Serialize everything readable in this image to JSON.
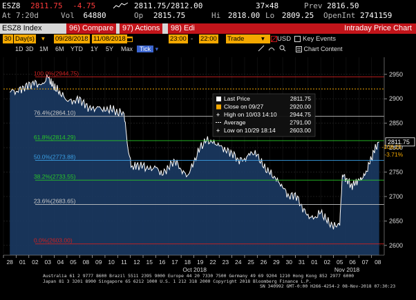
{
  "quote": {
    "ticker": "ESZ8",
    "last": "2811.75",
    "change": "-4.75",
    "bid_ask": "2811.75/2812.00",
    "size": "37×48",
    "prev_label": "Prev",
    "prev": "2816.50",
    "at_label": "At",
    "time": "7:20d",
    "vol_label": "Vol",
    "vol": "64880",
    "op_label": "Op",
    "open": "2815.75",
    "hi_label": "Hi",
    "high": "2818.00",
    "lo_label": "Lo",
    "low": "2809.25",
    "oi_label": "OpenInt",
    "open_int": "2741159"
  },
  "toolbar": {
    "security": "ESZ8 Index",
    "compare": "96) Compare",
    "actions": "97) Actions",
    "edit": "98) Edit",
    "title": "Intraday Price Chart"
  },
  "options": {
    "period_count": "30",
    "period_unit": "Day(s)",
    "start_date": "09/28/2018",
    "end_date": "11/08/2018",
    "start_time": "23:00",
    "end_time": "22:00",
    "field": "Trade",
    "currency": "USD",
    "key_events": "Key Events"
  },
  "ranges": {
    "items": [
      "1D",
      "3D",
      "1M",
      "6M",
      "YTD",
      "1Y",
      "5Y",
      "Max"
    ],
    "selected": "Tick",
    "chart_content": "Chart Content"
  },
  "legend": {
    "last_price_label": "Last Price",
    "last_price_value": "2811.75",
    "close_label": "Close on 09/27",
    "close_value": "2920.00",
    "high_label": "High on 10/03 14:10",
    "high_value": "2944.75",
    "avg_label": "Average",
    "avg_value": "2791.00",
    "low_label": "Low on 10/29 18:14",
    "low_value": "2603.00"
  },
  "annotations": {
    "last_tag": "2811.75",
    "change_pts": "-108.25",
    "change_pct": "-3.71%"
  },
  "fib_levels": [
    {
      "label": "100.0%(2944.75)",
      "value": 2944.75,
      "color": "#d02020"
    },
    {
      "label": "76.4%(2864.10)",
      "value": 2864.1,
      "color": "#c8c8c8"
    },
    {
      "label": "61.8%(2814.29)",
      "value": 2814.29,
      "color": "#28c828"
    },
    {
      "label": "50.0%(2773.88)",
      "value": 2773.88,
      "color": "#3aa0e6"
    },
    {
      "label": "38.2%(2733.55)",
      "value": 2733.55,
      "color": "#28c828"
    },
    {
      "label": "23.6%(2683.65)",
      "value": 2683.65,
      "color": "#c8c8c8"
    },
    {
      "label": "0.0%(2603.00)",
      "value": 2603.0,
      "color": "#d02020"
    }
  ],
  "footer": {
    "line1": "Australia 61 2 9777 8600 Brazil 5511 2395 9000 Europe 44 20 7330 7500 Germany 49 69 9204 1210 Hong Kong 852 2977 6000",
    "line2": "Japan 81 3 3201 8900         Singapore 65 6212 1000         U.S. 1 212 318 2000         Copyright 2018 Bloomberg Finance L.P.",
    "line3": "SN 340992 GMT-0:00 H266-4254-2 08-Nov-2018 07:30:23"
  },
  "colors": {
    "accent": "#f4a800",
    "bloomberg_red": "#c2141a",
    "area_fill": "#1b3a63",
    "price_line": "#ffffff",
    "close_line": "#f4a800"
  },
  "chart_data": {
    "type": "area",
    "ylim": [
      2580,
      2985
    ],
    "y_ticks": [
      2600,
      2650,
      2700,
      2750,
      2800,
      2850,
      2900,
      2950
    ],
    "x_tick_labels": [
      "28",
      "01",
      "02",
      "03",
      "04",
      "05",
      "08",
      "09",
      "10",
      "11",
      "12",
      "15",
      "16",
      "17",
      "18",
      "19",
      "22",
      "23",
      "24",
      "25",
      "26",
      "29",
      "30",
      "31",
      "01",
      "02",
      "05",
      "06",
      "07",
      "08"
    ],
    "month_labels": [
      {
        "label": "Oct 2018",
        "after_index": 15
      },
      {
        "label": "Nov 2018",
        "after_index": 27
      }
    ],
    "series": [
      {
        "name": "Last Price",
        "x": [
          0,
          0.5,
          1,
          1.5,
          2,
          2.5,
          3,
          3.3,
          3.6,
          4,
          4.5,
          5,
          5.5,
          6,
          6.5,
          7,
          7.5,
          8,
          8.5,
          9,
          9.3,
          9.6,
          10,
          10.5,
          11,
          11.5,
          12,
          12.5,
          13,
          13.5,
          14,
          14.5,
          15,
          15.5,
          16,
          16.5,
          17,
          17.5,
          18,
          18.5,
          19,
          19.5,
          20,
          20.5,
          21,
          21.5,
          22,
          22.5,
          23,
          23.5,
          24,
          24.5,
          25,
          25.5,
          26,
          26.5,
          27,
          27.5,
          28,
          28.3,
          28.6,
          29
        ],
        "values": [
          2918,
          2915,
          2922,
          2928,
          2932,
          2926,
          2945,
          2930,
          2922,
          2912,
          2898,
          2895,
          2900,
          2885,
          2878,
          2882,
          2876,
          2880,
          2872,
          2872,
          2800,
          2760,
          2763,
          2762,
          2755,
          2760,
          2745,
          2760,
          2775,
          2755,
          2742,
          2770,
          2800,
          2815,
          2810,
          2805,
          2795,
          2790,
          2775,
          2776,
          2790,
          2785,
          2760,
          2748,
          2735,
          2720,
          2700,
          2705,
          2680,
          2660,
          2655,
          2668,
          2650,
          2638,
          2645,
          2675,
          2690,
          2710,
          2730,
          2740,
          2725,
          2745
        ]
      }
    ],
    "tail_after_nov01": [
      2745,
      2735,
      2722,
      2730,
      2735,
      2745,
      2770,
      2795,
      2811.75
    ]
  }
}
